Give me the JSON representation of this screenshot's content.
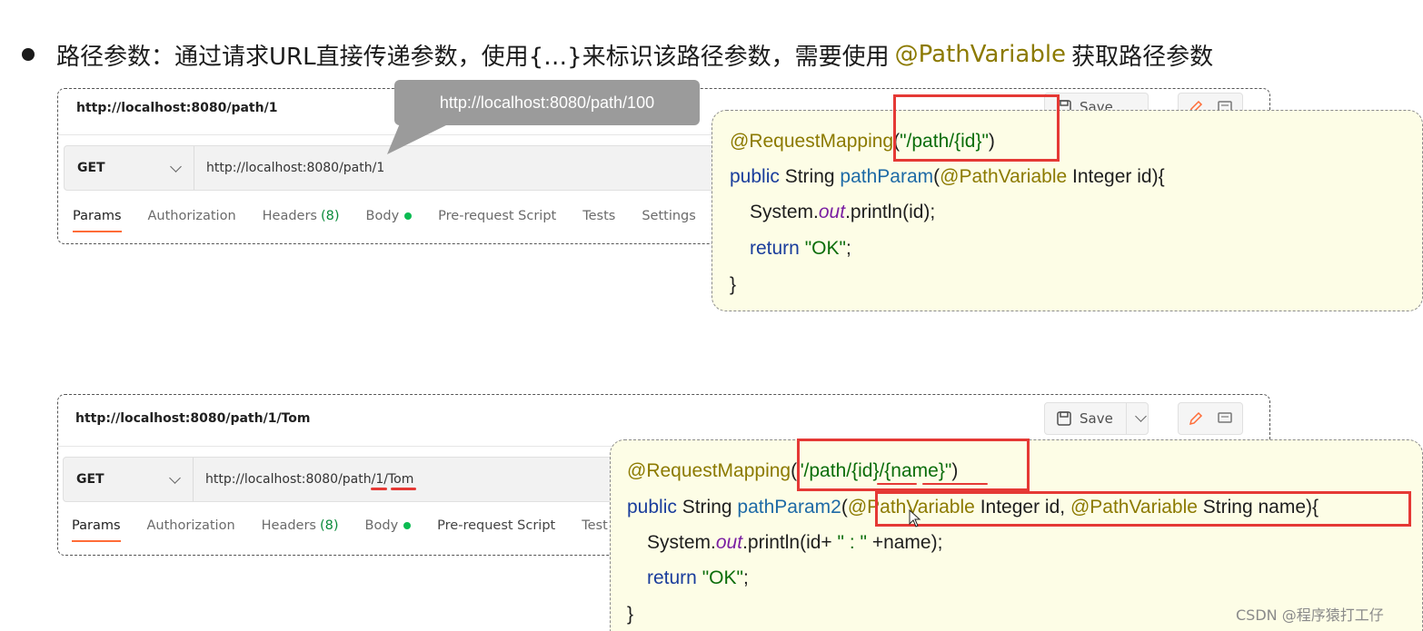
{
  "heading": {
    "text": "路径参数：通过请求URL直接传递参数，使用{…}来标识该路径参数，需要使用",
    "annotation": "@PathVariable",
    "suffix": "获取路径参数"
  },
  "panel1": {
    "title": "http://localhost:8080/path/1",
    "method": "GET",
    "url": "http://localhost:8080/path/1",
    "save_label": "Save",
    "tabs": [
      {
        "label": "Params",
        "active": true
      },
      {
        "label": "Authorization"
      },
      {
        "label": "Headers",
        "count": "(8)"
      },
      {
        "label": "Body",
        "dot": true
      },
      {
        "label": "Pre-request Script"
      },
      {
        "label": "Tests"
      },
      {
        "label": "Settings"
      }
    ]
  },
  "tooltip": {
    "text": "http://localhost:8080/path/100"
  },
  "code1": {
    "l1_ann": "@RequestMapping",
    "l1_open": "(",
    "l1_str": "\"/path/{id}\"",
    "l1_close": ")",
    "l2_kw": "public",
    "l2_type": "String",
    "l2_fn": "pathParam",
    "l2_open": "(",
    "l2_ann": "@PathVariable",
    "l2_rest": "Integer id){",
    "l3_a": "System.",
    "l3_field": "out",
    "l3_b": ".println(id);",
    "l4_kw": "return",
    "l4_str": "\"OK\"",
    "l4_end": ";",
    "l5": "}"
  },
  "panel2": {
    "title": "http://localhost:8080/path/1/Tom",
    "method": "GET",
    "url": "http://localhost:8080/path/1/Tom",
    "save_label": "Save",
    "tabs": [
      {
        "label": "Params",
        "active": true
      },
      {
        "label": "Authorization"
      },
      {
        "label": "Headers",
        "count": "(8)"
      },
      {
        "label": "Body",
        "dot": true
      },
      {
        "label": "Pre-request Script"
      },
      {
        "label": "Test"
      }
    ]
  },
  "code2": {
    "l1_ann": "@RequestMapping",
    "l1_open": "(",
    "l1_str": "\"/path/{id}/{name}\"",
    "l1_close": ")",
    "l2_kw": "public",
    "l2_type": "String",
    "l2_fn": "pathParam2",
    "l2_open": "(",
    "l2_ann1": "@PathVariable",
    "l2_mid": "Integer id,",
    "l2_ann2": "@PathVariable",
    "l2_rest": "String name){",
    "l3_a": "System.",
    "l3_field": "out",
    "l3_b": ".println(id+",
    "l3_str": "\" : \"",
    "l3_c": "+name);",
    "l4_kw": "return",
    "l4_str": "\"OK\"",
    "l4_end": ";",
    "l5": "}"
  },
  "watermark": "CSDN @程序猿打工仔",
  "colors": {
    "accent_tab": "#ff6c37",
    "highlight_red": "#e53935",
    "code_bg": "#fdfde6",
    "annotation": "#8c7a00"
  }
}
